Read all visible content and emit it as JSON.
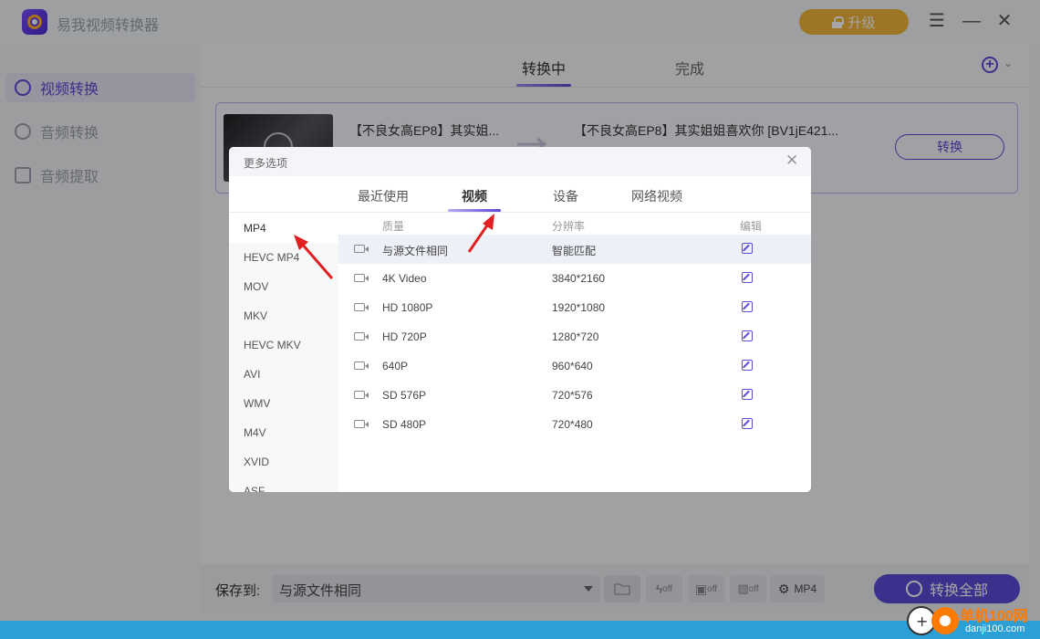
{
  "app": {
    "title": "易我视频转换器",
    "upgrade_label": "升级"
  },
  "window_controls": {
    "menu": "☰",
    "minimize": "—",
    "close": "✕"
  },
  "sidebar": {
    "items": [
      {
        "label": "视频转换",
        "active": true
      },
      {
        "label": "音频转换",
        "active": false
      },
      {
        "label": "音频提取",
        "active": false
      }
    ]
  },
  "main": {
    "tabs": [
      {
        "label": "转换中",
        "active": true
      },
      {
        "label": "完成",
        "active": false
      }
    ],
    "file": {
      "source_name": "【不良女高EP8】其实姐...",
      "output_name": "【不良女高EP8】其实姐姐喜欢你 [BV1jE421...",
      "convert_label": "转换"
    }
  },
  "bottom": {
    "save_label": "保存到:",
    "save_value": "与源文件相同",
    "tools": [
      "off",
      "off",
      "off"
    ],
    "format_label": "MP4",
    "convert_all_label": "转换全部"
  },
  "dialog": {
    "title": "更多选项",
    "tabs": [
      {
        "label": "最近使用",
        "active": false
      },
      {
        "label": "视频",
        "active": true
      },
      {
        "label": "设备",
        "active": false
      },
      {
        "label": "网络视频",
        "active": false
      }
    ],
    "formats": [
      "MP4",
      "HEVC MP4",
      "MOV",
      "MKV",
      "HEVC MKV",
      "AVI",
      "WMV",
      "M4V",
      "XVID",
      "ASF"
    ],
    "selected_format": "MP4",
    "columns": {
      "quality": "质量",
      "resolution": "分辨率",
      "edit": "编辑"
    },
    "rows": [
      {
        "quality": "与源文件相同",
        "resolution": "智能匹配"
      },
      {
        "quality": "4K Video",
        "resolution": "3840*2160"
      },
      {
        "quality": "HD 1080P",
        "resolution": "1920*1080"
      },
      {
        "quality": "HD 720P",
        "resolution": "1280*720"
      },
      {
        "quality": "640P",
        "resolution": "960*640"
      },
      {
        "quality": "SD 576P",
        "resolution": "720*576"
      },
      {
        "quality": "SD 480P",
        "resolution": "720*480"
      }
    ]
  },
  "watermark": {
    "brand": "单机100网",
    "url": "danji100.com"
  },
  "colors": {
    "accent": "#5b4ad6",
    "upgrade": "#f0b43a",
    "annotation": "#e02020"
  }
}
